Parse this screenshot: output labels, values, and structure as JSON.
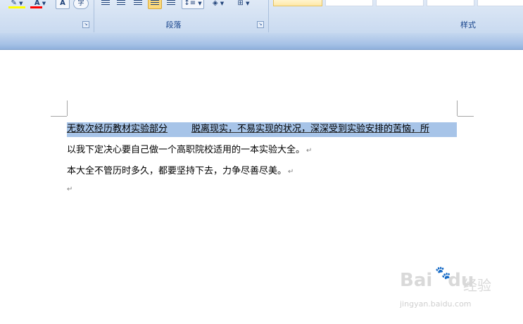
{
  "ribbon": {
    "groups": {
      "paragraph_label": "段落",
      "styles_label": "样式"
    },
    "font_buttons": {
      "font_color_glyph": "A",
      "char_shading_glyph": "A",
      "enclose_char_glyph": "字"
    },
    "colors": {
      "highlight": "#ffff00",
      "font_color": "#ff0000",
      "selection": "#a7c4e8",
      "label_text": "#15428b"
    }
  },
  "document": {
    "line1": {
      "seg1": "无数次经历教材实验部分",
      "seg2": "脱离现实，不易实现的状况，深深受到实验安排的苦恼，所"
    },
    "line2": "以我下定决心要自己做一个高职院校适用的一本实验大全。",
    "line3": "本大全不管历时多久，都要坚持下去，力争尽善尽美。",
    "para_mark": "↵"
  },
  "watermark": {
    "brand": "Bai",
    "brand_suffix": "du",
    "brand_cn": "经验",
    "url": "jingyan.baidu.com"
  }
}
